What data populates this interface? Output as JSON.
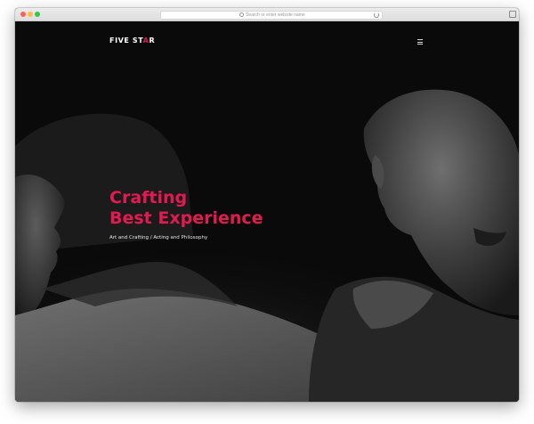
{
  "browser": {
    "address_placeholder": "Search or enter website name"
  },
  "site": {
    "logo_prefix": "FIVE ST",
    "logo_star": "A",
    "logo_suffix": "R"
  },
  "hero": {
    "headline_line1": "Crafting",
    "headline_line2": "Best Experience",
    "subtitle": "Art and Crafting / Acting and Philosophy"
  },
  "colors": {
    "accent": "#e21a52",
    "background": "#0a0a0a"
  },
  "icons": {
    "menu": "hamburger-menu-icon",
    "search": "search-icon",
    "reload": "reload-icon"
  }
}
